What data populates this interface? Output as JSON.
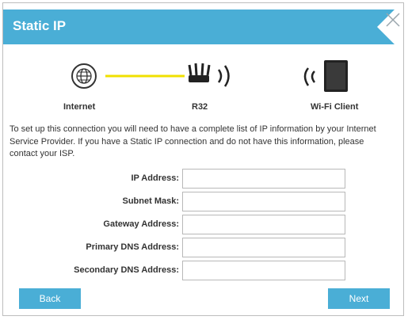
{
  "dialog": {
    "title": "Static IP",
    "accent_color": "#4aaed6",
    "close_icon": "close-icon"
  },
  "diagram": {
    "internet_label": "Internet",
    "router_label": "R32",
    "client_label": "Wi-Fi Client",
    "link_color": "#f0e000"
  },
  "description": "To set up this connection you will need to have a complete list of IP information by your Internet Service Provider. If you have a Static IP connection and do not have this information, please contact your ISP.",
  "form": {
    "fields": [
      {
        "label": "IP Address:",
        "value": ""
      },
      {
        "label": "Subnet Mask:",
        "value": ""
      },
      {
        "label": "Gateway Address:",
        "value": ""
      },
      {
        "label": "Primary DNS Address:",
        "value": ""
      },
      {
        "label": "Secondary DNS Address:",
        "value": ""
      }
    ]
  },
  "buttons": {
    "back": "Back",
    "next": "Next"
  }
}
